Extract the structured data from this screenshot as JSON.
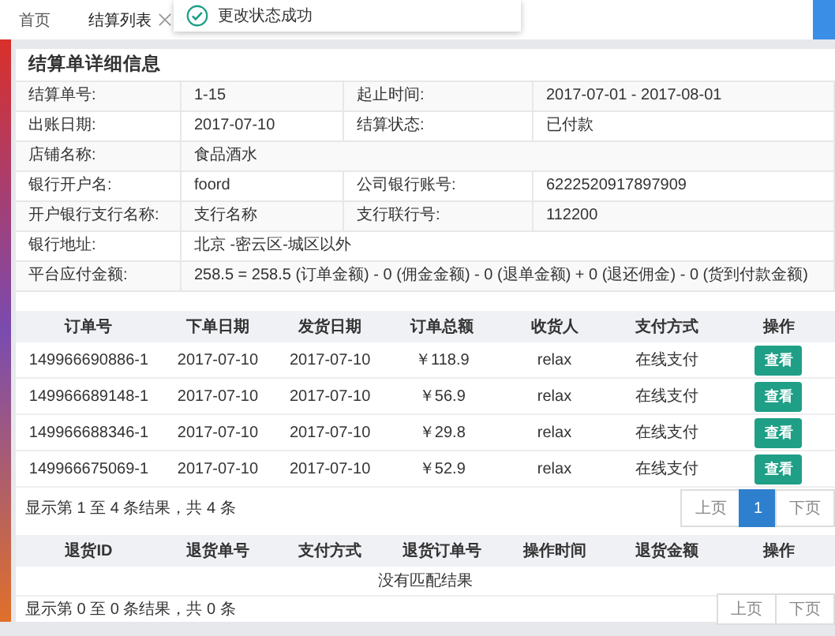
{
  "tabs": [
    {
      "label": "首页",
      "selected": false,
      "closable": false
    },
    {
      "label": "结算列表",
      "selected": true,
      "closable": true
    }
  ],
  "toast": {
    "message": "更改状态成功"
  },
  "detail": {
    "title": "结算单详细信息",
    "rows": [
      [
        {
          "label": "结算单号:",
          "value": "1-15"
        },
        {
          "label": "起止时间:",
          "value": "2017-07-01 - 2017-08-01"
        }
      ],
      [
        {
          "label": "出账日期:",
          "value": "2017-07-10"
        },
        {
          "label": "结算状态:",
          "value": "已付款"
        }
      ],
      [
        {
          "label": "店铺名称:",
          "value": "食品酒水"
        }
      ],
      [
        {
          "label": "银行开户名:",
          "value": "foord"
        },
        {
          "label": "公司银行账号:",
          "value": "6222520917897909"
        }
      ],
      [
        {
          "label": "开户银行支行名称:",
          "value": "支行名称"
        },
        {
          "label": "支行联行号:",
          "value": "112200"
        }
      ],
      [
        {
          "label": "银行地址:",
          "value": "北京 -密云区-城区以外"
        }
      ],
      [
        {
          "label": "平台应付金额:",
          "value": "258.5 = 258.5 (订单金额) - 0 (佣金金额) - 0 (退单金额) + 0 (退还佣金) - 0 (货到付款金额)"
        }
      ]
    ]
  },
  "orders": {
    "columns": [
      "订单号",
      "下单日期",
      "发货日期",
      "订单总额",
      "收货人",
      "支付方式",
      "操作"
    ],
    "rows": [
      {
        "cells": [
          "149966690886-1",
          "2017-07-10",
          "2017-07-10",
          "￥118.9",
          "relax",
          "在线支付"
        ],
        "action": "查看"
      },
      {
        "cells": [
          "149966689148-1",
          "2017-07-10",
          "2017-07-10",
          "￥56.9",
          "relax",
          "在线支付"
        ],
        "action": "查看"
      },
      {
        "cells": [
          "149966688346-1",
          "2017-07-10",
          "2017-07-10",
          "￥29.8",
          "relax",
          "在线支付"
        ],
        "action": "查看"
      },
      {
        "cells": [
          "149966675069-1",
          "2017-07-10",
          "2017-07-10",
          "￥52.9",
          "relax",
          "在线支付"
        ],
        "action": "查看"
      }
    ],
    "summary": "显示第 1 至 4 条结果，共 4 条",
    "pagination": [
      {
        "label": "上页",
        "selected": false
      },
      {
        "label": "1",
        "selected": true
      },
      {
        "label": "下页",
        "selected": false
      }
    ]
  },
  "returns": {
    "columns": [
      "退货ID",
      "退货单号",
      "支付方式",
      "退货订单号",
      "操作时间",
      "退货金额",
      "操作"
    ],
    "empty": "没有匹配结果",
    "summary": "显示第 0 至 0 条结果，共 0 条",
    "pagination": [
      {
        "label": "上页",
        "selected": false
      },
      {
        "label": "下页",
        "selected": false
      }
    ]
  }
}
